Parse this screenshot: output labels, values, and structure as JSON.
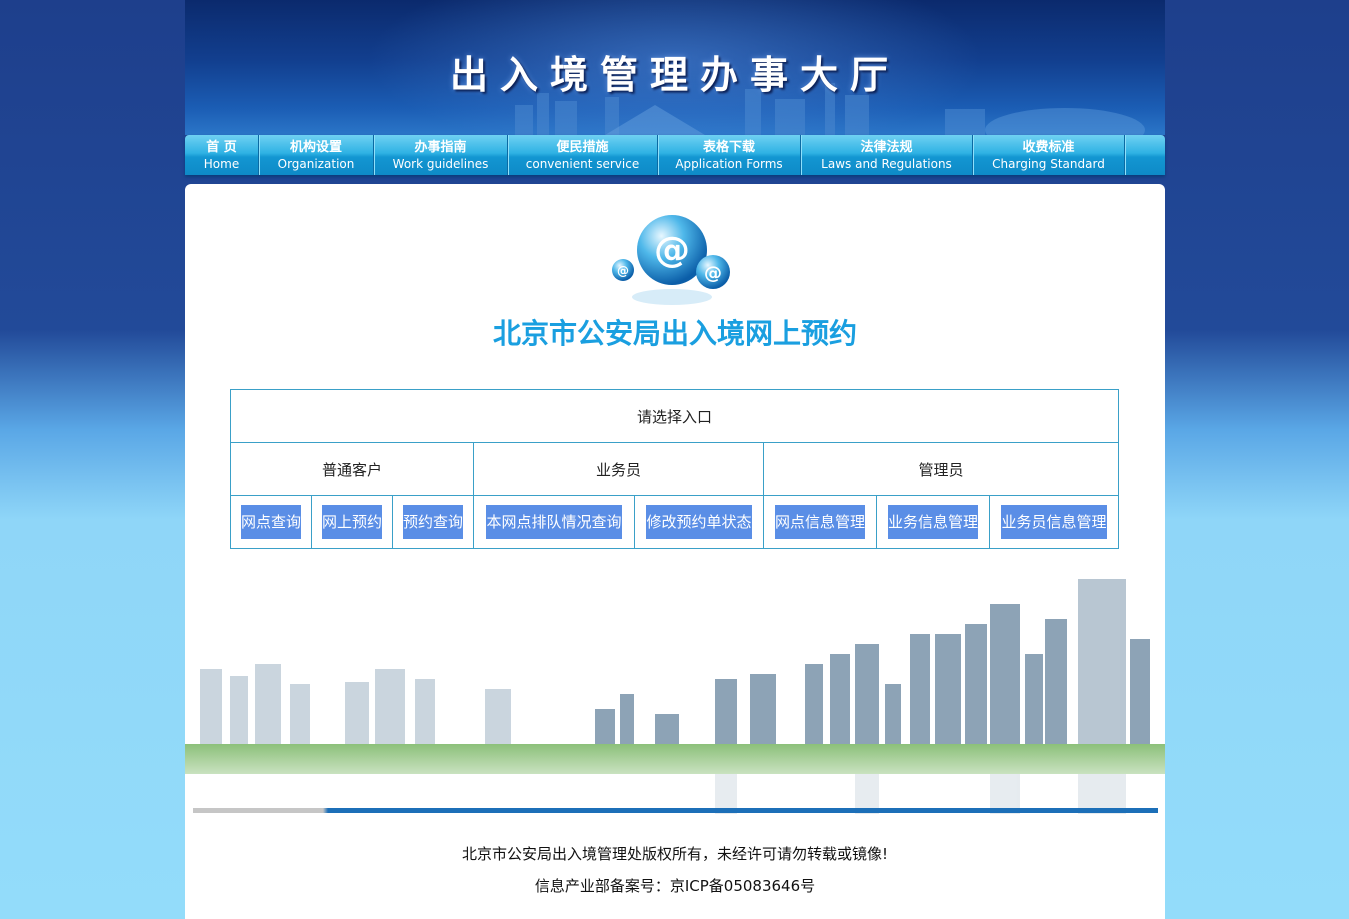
{
  "banner": {
    "title": "出入境管理办事大厅"
  },
  "nav": [
    {
      "cn": "首 页",
      "en": "Home"
    },
    {
      "cn": "机构设置",
      "en": "Organization"
    },
    {
      "cn": "办事指南",
      "en": "Work guidelines"
    },
    {
      "cn": "便民措施",
      "en": "convenient service"
    },
    {
      "cn": "表格下载",
      "en": "Application Forms"
    },
    {
      "cn": "法律法规",
      "en": "Laws and Regulations"
    },
    {
      "cn": "收费标准",
      "en": "Charging Standard"
    }
  ],
  "main": {
    "heading": "北京市公安局出入境网上预约",
    "table": {
      "header": "请选择入口",
      "groups": [
        "普通客户",
        "业务员",
        "管理员"
      ],
      "buttons": [
        "网点查询",
        "网上预约",
        "预约查询",
        "本网点排队情况查询",
        "修改预约单状态",
        "网点信息管理",
        "业务信息管理",
        "业务员信息管理"
      ]
    }
  },
  "footer": {
    "copyright": "北京市公安局出入境管理处版权所有，未经许可请勿转载或镜像!",
    "icp": "信息产业部备案号：京ICP备05083646号"
  },
  "colors": {
    "accent": "#1a9fe0",
    "button": "#5a8ee6",
    "border": "#3aa0c8"
  }
}
